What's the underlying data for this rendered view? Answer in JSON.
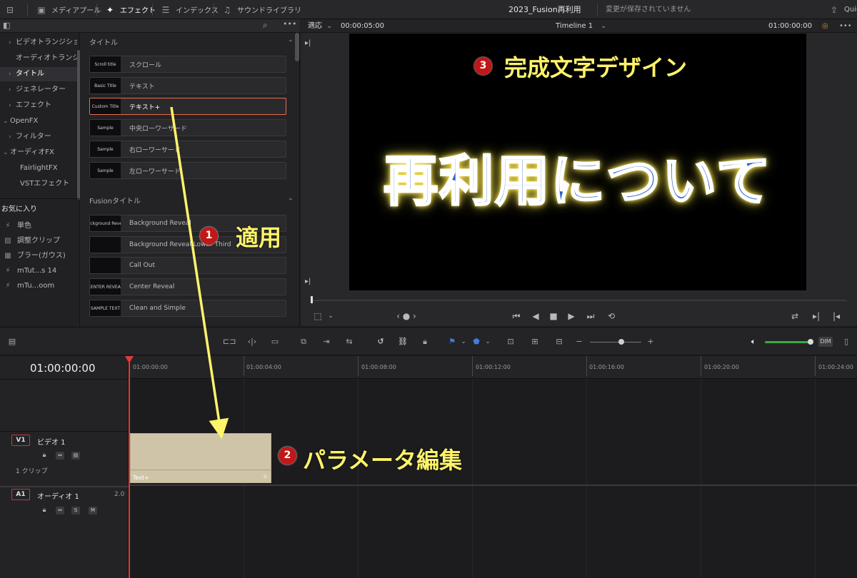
{
  "topbar": {
    "media_pool": "メディアプール",
    "effects": "エフェクト",
    "index": "インデックス",
    "sound_library": "サウンドライブラリ",
    "project_title": "2023_Fusion再利用",
    "save_status": "変更が保存されていません",
    "quick_export": "Quic"
  },
  "library": {
    "categories": [
      {
        "label": "ビデオトランジション",
        "arrow": "›"
      },
      {
        "label": "オーディオトランジ…",
        "arrow": ""
      },
      {
        "label": "タイトル",
        "arrow": "›"
      },
      {
        "label": "ジェネレーター",
        "arrow": "›"
      },
      {
        "label": "エフェクト",
        "arrow": "›"
      },
      {
        "label": "OpenFX",
        "arrow": "⌄"
      },
      {
        "label": "フィルター",
        "arrow": "›"
      },
      {
        "label": "オーディオFX",
        "arrow": "⌄"
      },
      {
        "label": "FairlightFX",
        "arrow": ""
      },
      {
        "label": "VSTエフェクト",
        "arrow": ""
      }
    ],
    "favorites_heading": "お気に入り",
    "favorites": [
      {
        "label": "単色",
        "icon": "⚡"
      },
      {
        "label": "調整クリップ",
        "icon": "▨"
      },
      {
        "label": "ブラー(ガウス)",
        "icon": "▦"
      },
      {
        "label": "mTut...s 14",
        "icon": "⚡"
      },
      {
        "label": "mTu...oom",
        "icon": "⚡"
      }
    ],
    "titles_heading": "タイトル",
    "titles": [
      {
        "thumb": "Scroll title",
        "label": "スクロール"
      },
      {
        "thumb": "Basic Title",
        "label": "テキスト"
      },
      {
        "thumb": "Custom Title",
        "label": "テキスト+"
      },
      {
        "thumb": "Sample",
        "label": "中央ローワーサード"
      },
      {
        "thumb": "Sample",
        "label": "右ローワーサード"
      },
      {
        "thumb": "Sample",
        "label": "左ローワーサード"
      }
    ],
    "fusion_heading": "Fusionタイトル",
    "fusion_titles": [
      {
        "thumb": "Background Reveal",
        "label": "Background Reveal"
      },
      {
        "thumb": "",
        "label": "Background Reveal Lower Third"
      },
      {
        "thumb": "",
        "label": "Call Out"
      },
      {
        "thumb": "CENTER REVEAL",
        "label": "Center Reveal"
      },
      {
        "thumb": "SAMPLE TEXT",
        "label": "Clean and Simple"
      }
    ]
  },
  "viewer": {
    "fit": "適応",
    "duration": "00:00:05:00",
    "timeline_name": "Timeline 1",
    "timecode": "01:00:00:00",
    "title_text": "再利用について"
  },
  "timeline": {
    "timecode": "01:00:00:00",
    "ruler": [
      "01:00:00:00",
      "01:00:04:00",
      "01:00:08:00",
      "01:00:12:00",
      "01:00:16:00",
      "01:00:20:00",
      "01:00:24:00"
    ],
    "video_track": {
      "badge": "V1",
      "name": "ビデオ 1",
      "clips": "1 クリップ"
    },
    "audio_track": {
      "badge": "A1",
      "name": "オーディオ 1",
      "level": "2.0",
      "solo": "S",
      "mute": "M"
    },
    "clip_name": "Text+",
    "dim": "DIM"
  },
  "annotations": {
    "step1_num": "1",
    "step1_text": "適用",
    "step2_num": "2",
    "step2_text": "パラメータ編集",
    "step3_num": "3",
    "step3_text": "完成文字デザイン"
  },
  "colors": {
    "accent_orange": "#e86c4a",
    "clip": "#cfc4a8",
    "playhead": "#e03a3a",
    "annotation_yellow": "#fff36a",
    "annotation_red": "#c01818"
  }
}
